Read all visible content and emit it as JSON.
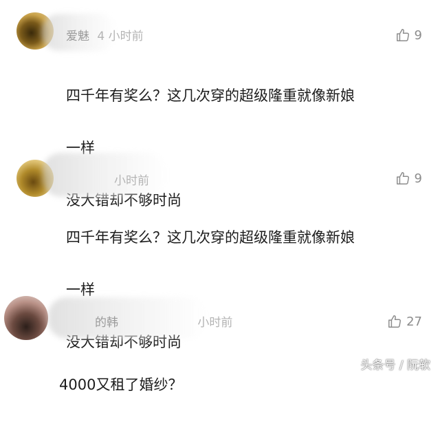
{
  "comments": [
    {
      "username": "爱魅",
      "time": "4 小时前",
      "likes": "9",
      "lines": [
        "四千年有奖么？这几次穿的超级隆重就像新娘",
        "一样",
        "没大错却不够时尚"
      ],
      "avatar_color": "#b48a2a"
    },
    {
      "username": "",
      "time": "小时前",
      "likes": "9",
      "lines": [
        "四千年有奖么？这几次穿的超级隆重就像新娘",
        "一样",
        "没大错却不够时尚"
      ],
      "avatar_color": "#c9a23a"
    },
    {
      "username": "的韩",
      "time": "小时前",
      "likes": "27",
      "lines": [
        "4000又租了婚纱？"
      ],
      "avatar_color": "#7a5a52"
    }
  ],
  "watermark": "头条号 / 阮软"
}
